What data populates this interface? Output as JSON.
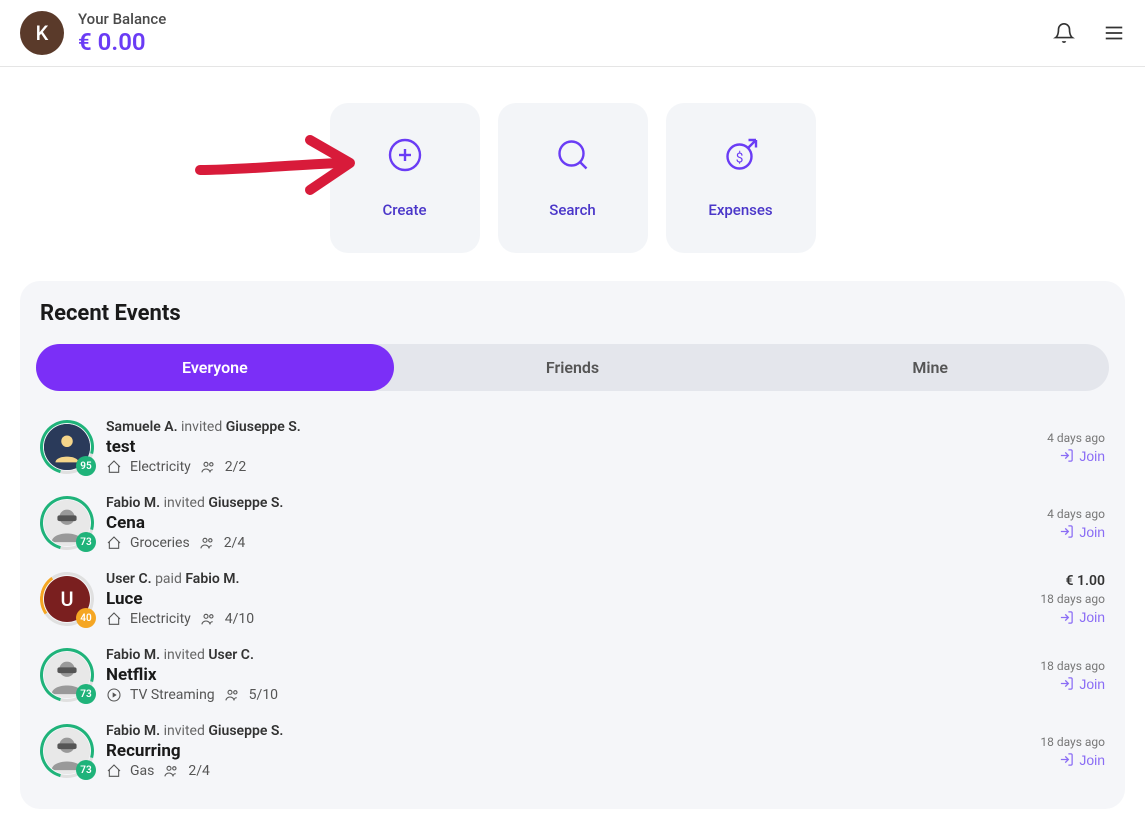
{
  "header": {
    "avatar_initial": "K",
    "balance_label": "Your Balance",
    "balance_amount": "€ 0.00"
  },
  "actions": {
    "create": "Create",
    "search": "Search",
    "expenses": "Expenses"
  },
  "recent": {
    "title": "Recent Events",
    "tabs": {
      "everyone": "Everyone",
      "friends": "Friends",
      "mine": "Mine"
    }
  },
  "colors": {
    "accent": "#7b2ff7",
    "accent2": "#6a3cf5"
  },
  "events": [
    {
      "who": "Samuele A.",
      "verb": "invited",
      "target": "Giuseppe S.",
      "title": "test",
      "category": "Electricity",
      "count": "2/2",
      "time": "4 days ago",
      "join": "Join",
      "amount": "",
      "avatar_type": "photo1",
      "ring": "green",
      "badge_color": "green",
      "badge": "95"
    },
    {
      "who": "Fabio M.",
      "verb": "invited",
      "target": "Giuseppe S.",
      "title": "Cena",
      "category": "Groceries",
      "count": "2/4",
      "time": "4 days ago",
      "join": "Join",
      "amount": "",
      "avatar_type": "photo2",
      "ring": "green",
      "badge_color": "green",
      "badge": "73"
    },
    {
      "who": "User C.",
      "verb": "paid",
      "target": "Fabio M.",
      "title": "Luce",
      "category": "Electricity",
      "count": "4/10",
      "time": "18 days ago",
      "join": "Join",
      "amount": "€ 1.00",
      "avatar_type": "initial",
      "avatar_initial": "U",
      "ring": "orange",
      "badge_color": "orange",
      "badge": "40"
    },
    {
      "who": "Fabio M.",
      "verb": "invited",
      "target": "User C.",
      "title": "Netflix",
      "category": "TV Streaming",
      "count": "5/10",
      "time": "18 days ago",
      "join": "Join",
      "amount": "",
      "avatar_type": "photo2",
      "ring": "green",
      "badge_color": "green",
      "badge": "73"
    },
    {
      "who": "Fabio M.",
      "verb": "invited",
      "target": "Giuseppe S.",
      "title": "Recurring",
      "category": "Gas",
      "count": "2/4",
      "time": "18 days ago",
      "join": "Join",
      "amount": "",
      "avatar_type": "photo2",
      "ring": "green",
      "badge_color": "green",
      "badge": "73"
    }
  ]
}
